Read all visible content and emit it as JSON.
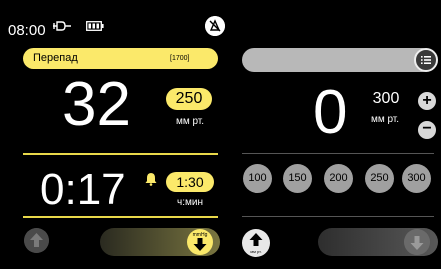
{
  "status_bar": {
    "time": "08:00",
    "icons": [
      "plug-icon",
      "battery-icon",
      "alarm-off-icon"
    ]
  },
  "left_panel": {
    "mode_label": "Перепад",
    "mode_code": "[1700]",
    "pressure": {
      "value": "32",
      "setpoint": "250",
      "unit": "мм рт."
    },
    "timer": {
      "value": "0:17",
      "setpoint": "1:30",
      "unit": "ч:мин",
      "icon": "bell-icon"
    },
    "controls": {
      "down_button_unit": "mmHg",
      "up_icon": "arrow-up-icon",
      "down_icon": "arrow-down-icon"
    }
  },
  "right_panel": {
    "pressure": {
      "value": "0",
      "setpoint": "300",
      "unit": "мм рт."
    },
    "plus_label": "+",
    "minus_label": "−",
    "presets": [
      "100",
      "150",
      "200",
      "250",
      "300"
    ],
    "controls": {
      "up_button_unit": "мм рт.",
      "menu_icon": "menu-icon"
    }
  },
  "colors": {
    "accent_yellow": "#fbe96a",
    "background": "#000000",
    "preset_gray": "#a0a0a0"
  }
}
